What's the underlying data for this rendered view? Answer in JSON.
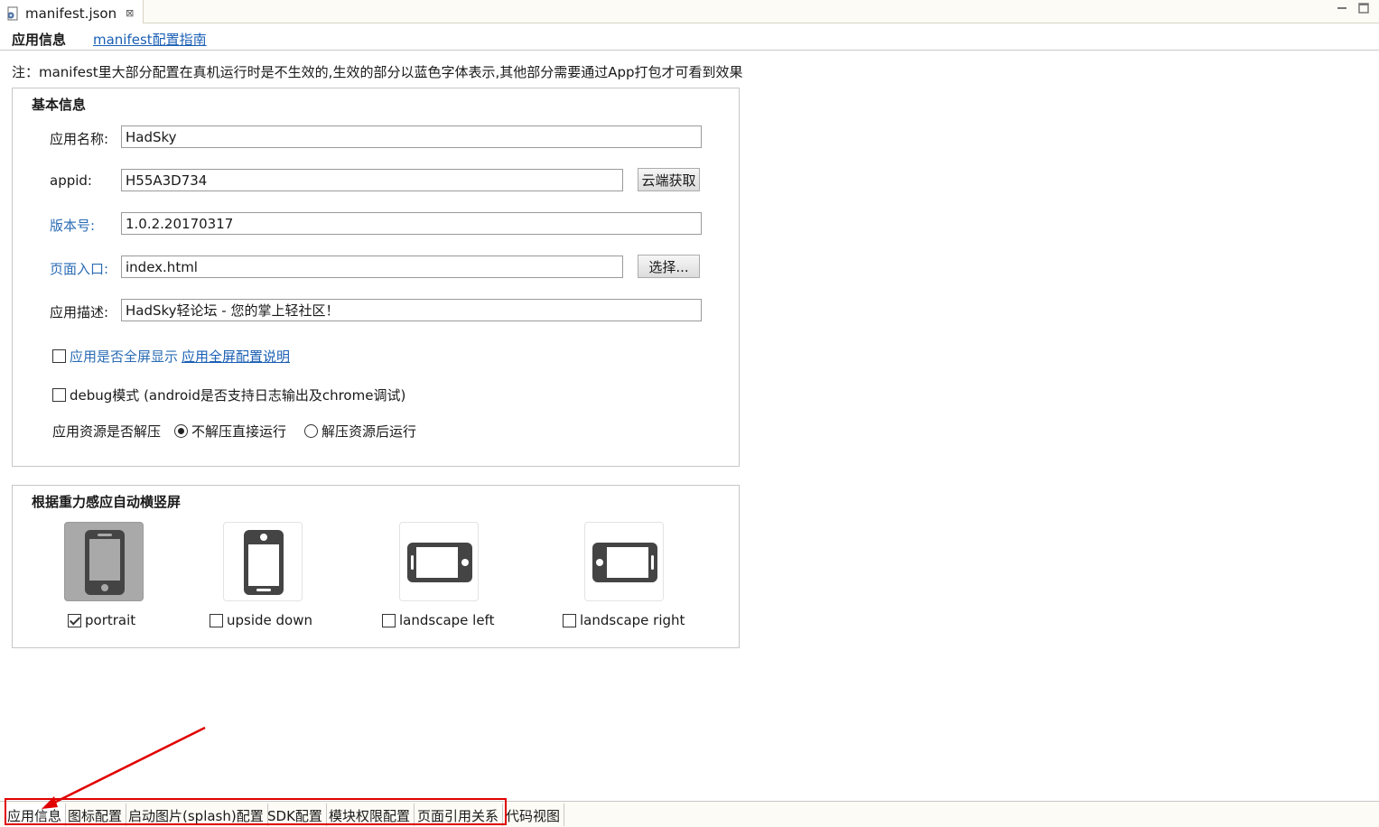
{
  "editor": {
    "file_name": "manifest.json",
    "file_icon": "json-file-icon",
    "close_icon": "close-icon"
  },
  "header": {
    "title": "应用信息",
    "guide_link": "manifest配置指南"
  },
  "note": "注：manifest里大部分配置在真机运行时是不生效的,生效的部分以蓝色字体表示,其他部分需要通过App打包才可看到效果",
  "basic": {
    "title": "基本信息",
    "app_name_label": "应用名称:",
    "app_name_value": "HadSky",
    "appid_label": "appid:",
    "appid_value": "H55A3D734",
    "appid_button": "云端获取",
    "version_label": "版本号:",
    "version_value": "1.0.2.20170317",
    "entry_label": "页面入口:",
    "entry_value": "index.html",
    "entry_button": "选择...",
    "desc_label": "应用描述:",
    "desc_value": "HadSky轻论坛 - 您的掌上轻社区！",
    "fullscreen_label": "应用是否全屏显示",
    "fullscreen_link": "应用全屏配置说明",
    "fullscreen_checked": false,
    "debug_label": "debug模式 (android是否支持日志输出及chrome调试)",
    "debug_checked": false,
    "decompress_label": "应用资源是否解压",
    "decompress_options": [
      "不解压直接运行",
      "解压资源后运行"
    ],
    "decompress_selected": "不解压直接运行"
  },
  "orientation": {
    "title": "根据重力感应自动横竖屏",
    "options": [
      {
        "label": "portrait",
        "checked": true,
        "icon": "portrait-phone-icon"
      },
      {
        "label": "upside down",
        "checked": false,
        "icon": "upside-down-phone-icon"
      },
      {
        "label": "landscape left",
        "checked": false,
        "icon": "landscape-left-phone-icon"
      },
      {
        "label": "landscape right",
        "checked": false,
        "icon": "landscape-right-phone-icon"
      }
    ]
  },
  "bottom_tabs": [
    "应用信息",
    "图标配置",
    "启动图片(splash)配置",
    "SDK配置",
    "模块权限配置",
    "页面引用关系",
    "代码视图"
  ],
  "active_bottom_tab": "应用信息",
  "colors": {
    "accent_blue": "#2a6cb5",
    "link_blue": "#1a5fb4",
    "annotation_red": "#e00000",
    "selected_tile": "#a9a9a9"
  }
}
